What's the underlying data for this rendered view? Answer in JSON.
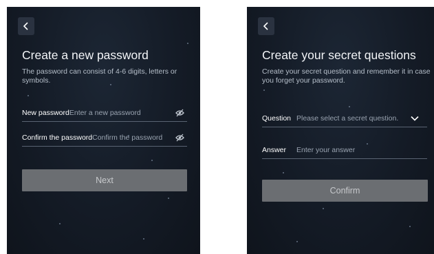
{
  "password_screen": {
    "title": "Create a new password",
    "description": "The password can consist of 4-6 digits, letters or symbols.",
    "new_password": {
      "label": "New password",
      "placeholder": "Enter a new password"
    },
    "confirm_password": {
      "label": "Confirm the password",
      "placeholder": "Confirm the password"
    },
    "next_label": "Next"
  },
  "secret_screen": {
    "title": "Create your secret questions",
    "description": "Create your secret question and remember it in case you forget your password.",
    "question": {
      "label": "Question",
      "placeholder": "Please select a secret question."
    },
    "answer": {
      "label": "Answer",
      "placeholder": "Enter your answer"
    },
    "confirm_label": "Confirm"
  },
  "icons": {
    "back": "chevron-left-icon",
    "password_visibility": "eye-off-icon",
    "question_dropdown": "chevron-down-icon"
  },
  "colors": {
    "background": "#141b26",
    "button_disabled": "#6b6e72",
    "divider": "#5a6473"
  }
}
